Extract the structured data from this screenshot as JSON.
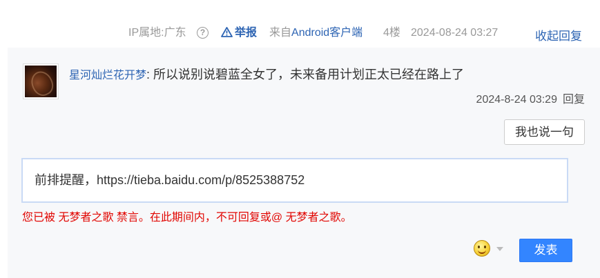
{
  "post_tail": {
    "ip_location": "IP属地:广东",
    "help_glyph": "?",
    "report_label": "举报",
    "source_prefix": "来自",
    "source_client": "Android客户端",
    "floor": "4楼",
    "time": "2024-08-24 03:27",
    "collapse_reply_label": "收起回复"
  },
  "reply": {
    "username": "星河灿烂花开梦",
    "separator": ":",
    "content": " 所以说别说碧蓝全女了，未来备用计划正太已经在路上了",
    "time": "2024-8-24 03:29",
    "reply_label": "回复"
  },
  "say_button_label": "我也说一句",
  "editor": {
    "value": "前排提醒，https://tieba.baidu.com/p/8525388752"
  },
  "ban_notice": "您已被 无梦者之歌 禁言。在此期间内，不可回复或@ 无梦者之歌。",
  "submit_label": "发表",
  "icons": {
    "help": "question-circle-icon",
    "report": "warning-triangle-icon",
    "emoji": "smiley-emoji-icon",
    "caret": "caret-down-icon"
  },
  "colors": {
    "link": "#2d64b3",
    "submit_bg": "#3385ff",
    "ban_text": "#e10602",
    "panel_bg": "#f7f8fa"
  }
}
